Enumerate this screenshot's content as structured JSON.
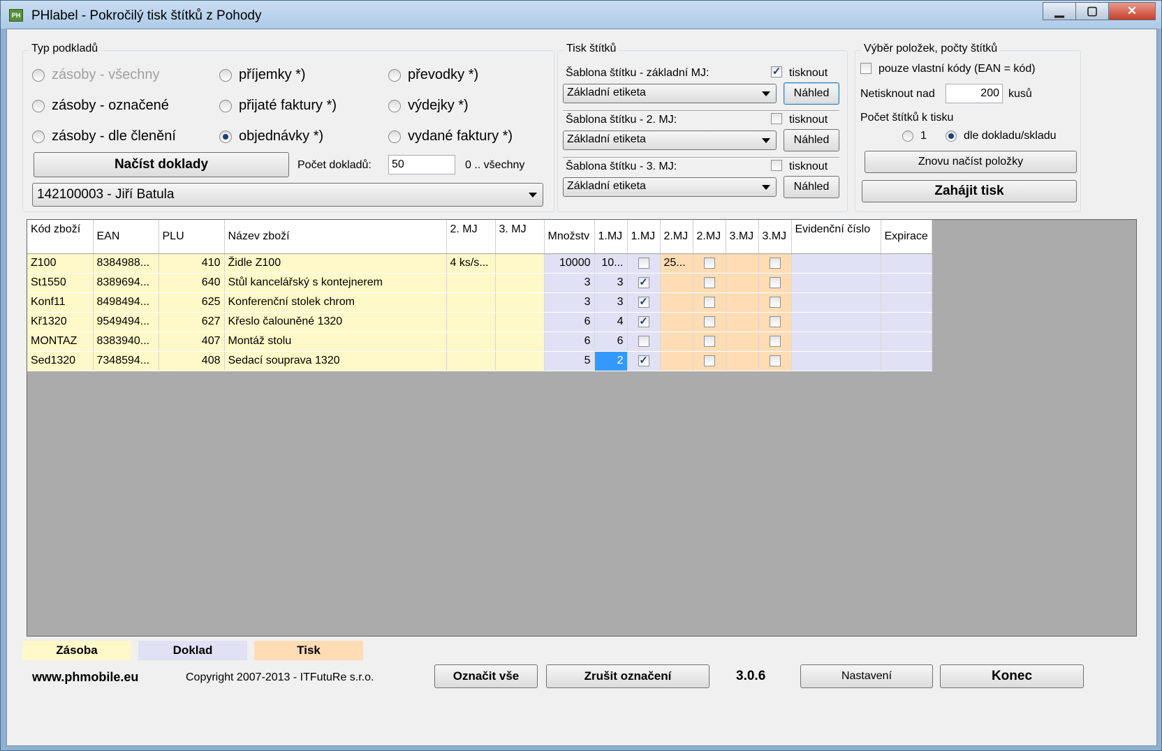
{
  "window": {
    "title": "PHlabel - Pokročilý tisk štítků z Pohody",
    "app_icon": "PH",
    "min": "▁",
    "max": "▢",
    "close": "✕"
  },
  "typ_podkladu": {
    "label": "Typ podkladů",
    "options": [
      {
        "label": "zásoby - všechny",
        "selected": false,
        "disabled": true
      },
      {
        "label": "zásoby - označené",
        "selected": false,
        "disabled": false
      },
      {
        "label": "zásoby - dle členění",
        "selected": false,
        "disabled": false
      },
      {
        "label": "příjemky *)",
        "selected": false,
        "disabled": false
      },
      {
        "label": "přijaté faktury *)",
        "selected": false,
        "disabled": false
      },
      {
        "label": "objednávky *)",
        "selected": true,
        "disabled": false
      },
      {
        "label": "převodky *)",
        "selected": false,
        "disabled": false
      },
      {
        "label": "výdejky *)",
        "selected": false,
        "disabled": false
      },
      {
        "label": "vydané faktury *)",
        "selected": false,
        "disabled": false
      }
    ],
    "nacist_button": "Načíst doklady",
    "pocet_label": "Počet dokladů:",
    "pocet_value": "50",
    "pocet_hint": "0 .. všechny",
    "doklad_select": "142100003 - Jiří Batula"
  },
  "tisk_stitku": {
    "label": "Tisk štítků",
    "templates": [
      {
        "label": "Šablona štítku - základní MJ:",
        "value": "Základní etiketa",
        "print_label": "tisknout",
        "print": true,
        "preview": "Náhled"
      },
      {
        "label": "Šablona štítku - 2. MJ:",
        "value": "Základní etiketa",
        "print_label": "tisknout",
        "print": false,
        "preview": "Náhled"
      },
      {
        "label": "Šablona štítku - 3. MJ:",
        "value": "Základní etiketa",
        "print_label": "tisknout",
        "print": false,
        "preview": "Náhled"
      }
    ]
  },
  "vyber": {
    "label": "Výběr položek, počty štítků",
    "vlastni_kody": "pouze vlastní kódy (EAN = kód)",
    "vlastni_kody_checked": false,
    "netisknout_label": "Netisknout nad",
    "netisknout_value": "200",
    "netisknout_unit": "kusů",
    "pocet_label": "Počet štítků k tisku",
    "pocet_opt1": "1",
    "pocet_opt2": "dle dokladu/skladu",
    "pocet_selected": 2,
    "reload_button": "Znovu načíst položky",
    "start_button": "Zahájit tisk"
  },
  "grid": {
    "headers": [
      "Kód zboží",
      "EAN",
      "PLU",
      "Název zboží",
      "2. MJ",
      "3. MJ",
      "Množstv",
      "1.MJ",
      "1.MJ",
      "2.MJ",
      "2.MJ",
      "3.MJ",
      "3.MJ",
      "Evidenční číslo",
      "Expirace"
    ],
    "rows": [
      {
        "kod": "Z100",
        "ean": "8384988...",
        "plu": "410",
        "nazev": "Židle Z100",
        "mj2": "4 ks/s...",
        "mj3": "",
        "mnozstvi": "10000",
        "mj1n": "10...",
        "mj1c": false,
        "mj2n": "25...",
        "mj2c": false,
        "mj3n": "",
        "mj3c": false,
        "evid": "",
        "exp": ""
      },
      {
        "kod": "St1550",
        "ean": "8389694...",
        "plu": "640",
        "nazev": "Stůl kancelářský s kontejnerem",
        "mj2": "",
        "mj3": "",
        "mnozstvi": "3",
        "mj1n": "3",
        "mj1c": true,
        "mj2n": "",
        "mj2c": false,
        "mj3n": "",
        "mj3c": false,
        "evid": "",
        "exp": ""
      },
      {
        "kod": "Konf11",
        "ean": "8498494...",
        "plu": "625",
        "nazev": "Konferenční stolek chrom",
        "mj2": "",
        "mj3": "",
        "mnozstvi": "3",
        "mj1n": "3",
        "mj1c": true,
        "mj2n": "",
        "mj2c": false,
        "mj3n": "",
        "mj3c": false,
        "evid": "",
        "exp": ""
      },
      {
        "kod": "Kř1320",
        "ean": "9549494...",
        "plu": "627",
        "nazev": "Křeslo čalouněné 1320",
        "mj2": "",
        "mj3": "",
        "mnozstvi": "6",
        "mj1n": "4",
        "mj1c": true,
        "mj2n": "",
        "mj2c": false,
        "mj3n": "",
        "mj3c": false,
        "evid": "",
        "exp": ""
      },
      {
        "kod": "MONTAZ",
        "ean": "8383940...",
        "plu": "407",
        "nazev": "Montáž stolu",
        "mj2": "",
        "mj3": "",
        "mnozstvi": "6",
        "mj1n": "6",
        "mj1c": false,
        "mj2n": "",
        "mj2c": false,
        "mj3n": "",
        "mj3c": false,
        "evid": "",
        "exp": ""
      },
      {
        "kod": "Sed1320",
        "ean": "7348594...",
        "plu": "408",
        "nazev": "Sedací souprava 1320",
        "mj2": "",
        "mj3": "",
        "mnozstvi": "5",
        "mj1n": "2",
        "mj1c": true,
        "mj2n": "",
        "mj2c": false,
        "mj3n": "",
        "mj3c": false,
        "evid": "",
        "exp": "",
        "selected_cell": "mj1n"
      }
    ]
  },
  "legend": {
    "zasoba": "Zásoba",
    "doklad": "Doklad",
    "tisk": "Tisk",
    "zasoba_color": "#fff8c8",
    "doklad_color": "#e1e1f5",
    "tisk_color": "#ffdcb4"
  },
  "footer": {
    "website": "www.phmobile.eu",
    "copyright": "Copyright 2007-2013 - ITFutuRe s.r.o.",
    "oznacit": "Označit vše",
    "zrusit": "Zrušit označení",
    "version": "3.0.6",
    "nastaveni": "Nastavení",
    "konec": "Konec"
  }
}
